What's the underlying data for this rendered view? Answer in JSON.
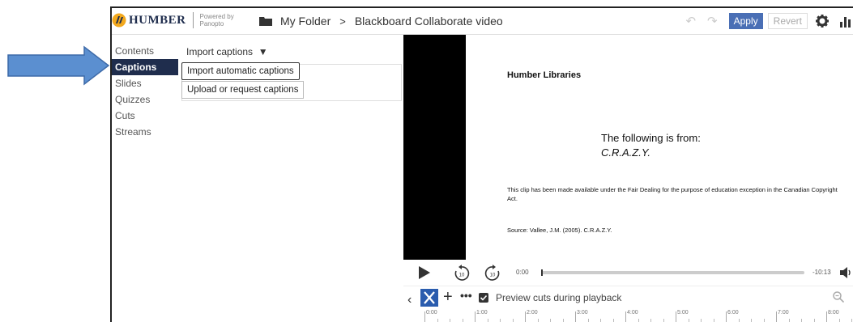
{
  "header": {
    "brand": "HUMBER",
    "powered_line1": "Powered by",
    "powered_line2": "Panopto",
    "folder": "My Folder",
    "separator": ">",
    "video_title": "Blackboard Collaborate video",
    "apply_label": "Apply",
    "revert_label": "Revert"
  },
  "sidebar": {
    "items": [
      {
        "label": "Contents"
      },
      {
        "label": "Captions"
      },
      {
        "label": "Slides"
      },
      {
        "label": "Quizzes"
      },
      {
        "label": "Cuts"
      },
      {
        "label": "Streams"
      }
    ],
    "active": "Captions"
  },
  "captions_panel": {
    "menu_label": "Import captions",
    "options": [
      "Import automatic captions",
      "Upload or request captions"
    ]
  },
  "slide": {
    "org": "Humber Libraries",
    "line1": "The following is from:",
    "line2": "C.R.A.Z.Y.",
    "notice": "This clip has been made available under the Fair Dealing for the purpose of education exception in the Canadian Copyright Act.",
    "source": "Source: Vallee, J.M. (2005). C.R.A.Z.Y."
  },
  "player": {
    "current_time": "0:00",
    "remaining_time": "-10:13",
    "progress": 0
  },
  "editor": {
    "preview_label": "Preview cuts during playback",
    "preview_checked": true,
    "timeline_ticks": [
      "0:00",
      "1:00",
      "2:00",
      "3:00",
      "4:00",
      "5:00",
      "6:00",
      "7:00",
      "8:00"
    ]
  },
  "colors": {
    "brand_navy": "#1f2d4d",
    "accent_blue": "#4a6fb5",
    "arrow_blue": "#5b8fd0"
  },
  "icons": [
    "humber-logo-icon",
    "folder-icon",
    "undo-icon",
    "redo-icon",
    "gear-icon",
    "stats-icon",
    "play-icon",
    "rewind-10-icon",
    "forward-10-icon",
    "volume-icon",
    "scissors-icon",
    "plus-icon",
    "more-icon",
    "checkbox-icon",
    "zoom-icon",
    "pointer-arrow"
  ]
}
